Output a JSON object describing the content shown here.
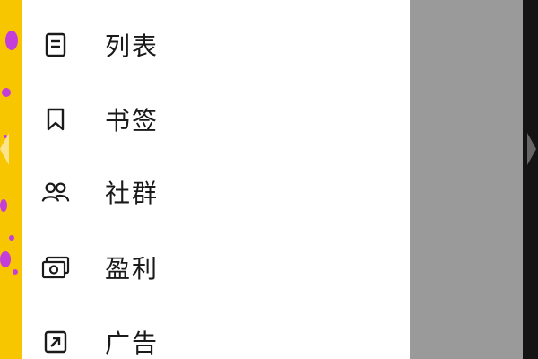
{
  "menu": {
    "items": [
      {
        "label": "列表",
        "icon": "list-icon"
      },
      {
        "label": "书签",
        "icon": "bookmark-icon"
      },
      {
        "label": "社群",
        "icon": "community-icon"
      },
      {
        "label": "盈利",
        "icon": "monetization-icon"
      },
      {
        "label": "广告",
        "icon": "ads-icon"
      }
    ]
  },
  "background": {
    "more_glyph": "···"
  },
  "colors": {
    "drawer": "#ffffff",
    "text": "#1a1a1a",
    "dim_overlay": "#9a9a9a",
    "left_background": "#f7c600",
    "left_dots": "#c43fd9"
  }
}
